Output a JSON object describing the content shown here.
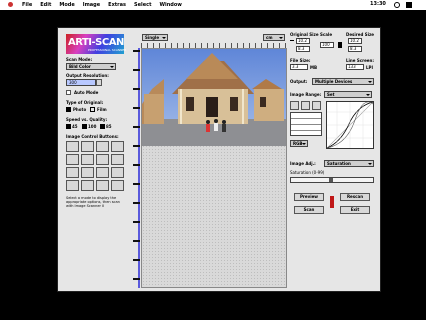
{
  "menubar": {
    "apple": "",
    "items": [
      "File",
      "Edit",
      "Mode",
      "Image",
      "Extras",
      "Select",
      "Window"
    ],
    "clock": "13:30"
  },
  "logo": {
    "text": "ARTI-SCAN",
    "subtitle": "PROFESSIONAL SCANNER"
  },
  "left": {
    "scan_mode_label": "Scan Mode:",
    "scan_mode_value": "Bild Color",
    "output_resolution_label": "Output Resolution:",
    "output_resolution_value": "300",
    "auto_mode_label": "Auto Mode",
    "type_of_original_label": "Type of Original:",
    "photo_label": "Photo",
    "film_label": "Film",
    "speed_label": "Speed vs. Quality:",
    "speed_options": [
      "45",
      "100",
      "85"
    ],
    "controls_label": "Image Control Buttons:",
    "footer_text": "Select a mode to display the appropriate options, then scan with Image Scanner II"
  },
  "preview": {
    "zoom_label": "Single",
    "unit_label": "cm"
  },
  "right": {
    "original_size_label": "Original Size",
    "scale_label": "Scale",
    "desired_size_label": "Desired Size",
    "w_value": "10.2",
    "h_value": "8.3",
    "scale_value": "100",
    "desired_w": "10.2",
    "desired_h": "8.3",
    "file_size_label": "File Size:",
    "file_size_value": "3.3",
    "file_size_unit": "MB",
    "line_screen_label": "Line Screen:",
    "line_screen_value": "133",
    "line_screen_unit": "LPI",
    "output_label": "Output:",
    "output_value": "Multiple Devices",
    "image_range_label": "Image Range:",
    "image_range_value": "Set",
    "rgb_label": "RGB",
    "image_adj_label": "Image Adj.:",
    "image_adj_value": "Saturation",
    "saturation_label": "Saturation (0-99)",
    "preview_button": "Preview",
    "rescan_button": "Rescan",
    "scan_button": "Scan",
    "exit_button": "Exit"
  },
  "colors": {
    "window_bg": "#e6e6e6",
    "accent": "#5a5adc",
    "red_arrow": "#c01818"
  }
}
